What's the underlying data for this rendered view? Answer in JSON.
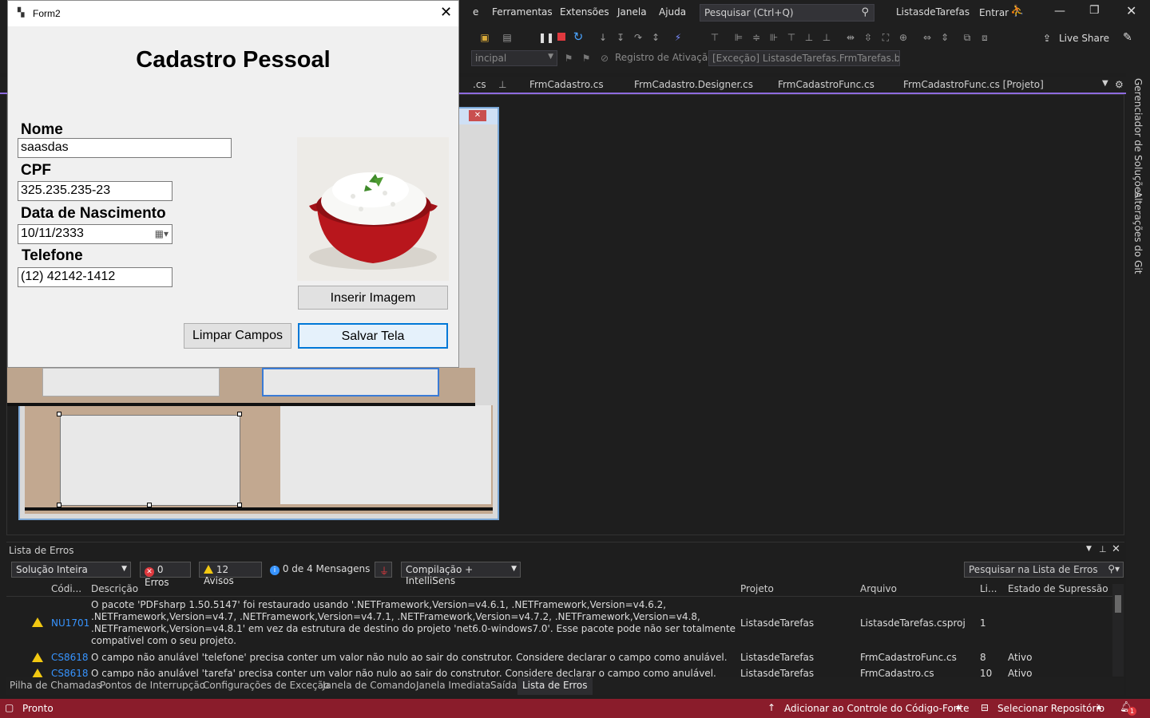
{
  "vs": {
    "menu": [
      "Ferramentas",
      "Extensões",
      "Janela",
      "Ajuda"
    ],
    "search_placeholder": "Pesquisar (Ctrl+Q)",
    "solution_name": "ListasdeTarefas",
    "signin": "Entrar",
    "live_share": "Live Share",
    "config_combo": "incipal",
    "activation_label": "Registro de Ativação:",
    "activation_value": "[Exceção] ListasdeTarefas.FrmTarefas.btnIr",
    "tabs": [
      ".cs",
      "FrmCadastro.cs",
      "FrmCadastro.Designer.cs",
      "FrmCadastroFunc.cs",
      "FrmCadastroFunc.cs [Projeto]"
    ],
    "rail": [
      "Gerenciador de Soluções",
      "Alterações do Git"
    ]
  },
  "form2": {
    "title": "Form2",
    "heading": "Cadastro Pessoal",
    "nome_label": "Nome",
    "nome_value": "saasdas",
    "cpf_label": "CPF",
    "cpf_value": "325.235.235-23",
    "data_label": "Data de Nascimento",
    "data_value": "10/11/2333",
    "telefone_label": "Telefone",
    "telefone_value": "(12) 42142-1412",
    "inserir_button": "Inserir Imagem",
    "limpar_button": "Limpar Campos",
    "salvar_button": "Salvar Tela"
  },
  "error_list": {
    "title": "Lista de Erros",
    "scope": "Solução Inteira",
    "errors": "0 Erros",
    "warnings": "12 Avisos",
    "messages": "0 de 4 Mensagens",
    "build_filter": "Compilação + IntelliSens",
    "search_placeholder": "Pesquisar na Lista de Erros",
    "columns": {
      "code": "Códi...",
      "description": "Descrição",
      "project": "Projeto",
      "file": "Arquivo",
      "line": "Li...",
      "suppression": "Estado de Supressão"
    },
    "rows": [
      {
        "code": "NU1701",
        "description": "O pacote 'PDFsharp 1.50.5147' foi restaurado usando '.NETFramework,Version=v4.6.1, .NETFramework,Version=v4.6.2, .NETFramework,Version=v4.7, .NETFramework,Version=v4.7.1, .NETFramework,Version=v4.7.2, .NETFramework,Version=v4.8, .NETFramework,Version=v4.8.1' em vez da estrutura de destino do projeto 'net6.0-windows7.0'. Esse pacote pode não ser totalmente compatível com o seu projeto.",
        "project": "ListasdeTarefas",
        "file": "ListasdeTarefas.csproj",
        "line": "1",
        "suppression": ""
      },
      {
        "code": "CS8618",
        "description": "O campo não anulável 'telefone' precisa conter um valor não nulo ao sair do construtor. Considere declarar o campo como anulável.",
        "project": "ListasdeTarefas",
        "file": "FrmCadastroFunc.cs",
        "line": "8",
        "suppression": "Ativo"
      },
      {
        "code": "CS8618",
        "description": "O campo não anulável 'tarefa' precisa conter um valor não nulo ao sair do construtor. Considere declarar o campo como anulável.",
        "project": "ListasdeTarefas",
        "file": "FrmCadastro.cs",
        "line": "10",
        "suppression": "Ativo"
      }
    ]
  },
  "bottom_tabs": [
    "Pilha de Chamadas",
    "Pontos de Interrupção",
    "Configurações de Exceção",
    "Janela de Comando",
    "Janela Imediata",
    "Saída",
    "Lista de Erros"
  ],
  "status": {
    "ready": "Pronto",
    "source_control": "Adicionar ao Controle do Código-Fonte",
    "repo": "Selecionar Repositório",
    "notifications": "1"
  }
}
